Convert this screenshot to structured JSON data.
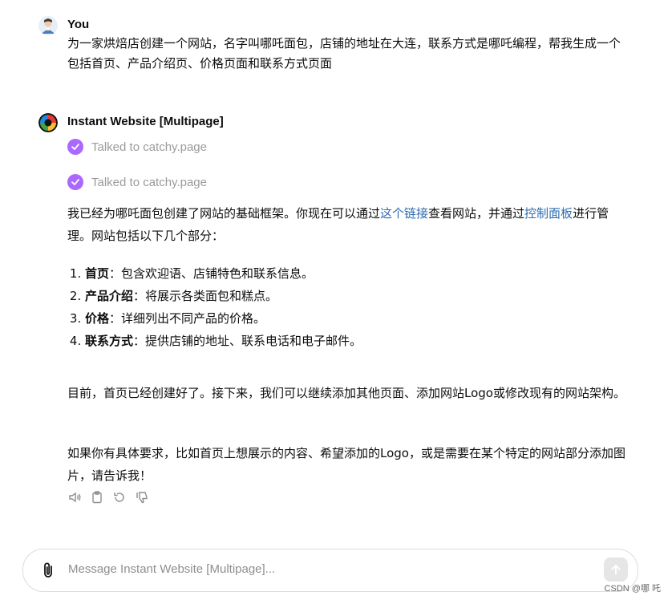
{
  "user_message": {
    "author": "You",
    "text": "为一家烘焙店创建一个网站，名字叫哪吒面包，店铺的地址在大连，联系方式是哪吒编程，帮我生成一个包括首页、产品介绍页、价格页面和联系方式页面"
  },
  "assistant_message": {
    "author": "Instant Website [Multipage]",
    "tool_calls": [
      "Talked to catchy.page",
      "Talked to catchy.page"
    ],
    "intro_1": "我已经为哪吒面包创建了网站的基础框架。你现在可以通过",
    "link_1": "这个链接",
    "intro_2": "查看网站，并通过",
    "link_2": "控制面板",
    "intro_3": "进行管理。网站包括以下几个部分：",
    "sections": [
      {
        "title": "首页",
        "desc": "：包含欢迎语、店铺特色和联系信息。"
      },
      {
        "title": "产品介绍",
        "desc": "：将展示各类面包和糕点。"
      },
      {
        "title": "价格",
        "desc": "：详细列出不同产品的价格。"
      },
      {
        "title": "联系方式",
        "desc": "：提供店铺的地址、联系电话和电子邮件。"
      }
    ],
    "para_2": "目前，首页已经创建好了。接下来，我们可以继续添加其他页面、添加网站Logo或修改现有的网站架构。",
    "para_3": "如果你有具体要求，比如首页上想展示的内容、希望添加的Logo，或是需要在某个特定的网站部分添加图片，请告诉我！"
  },
  "composer": {
    "placeholder": "Message Instant Website [Multipage]..."
  },
  "watermark": "CSDN @哪 吒",
  "colors": {
    "check_purple": "#ab68ff",
    "link_blue": "#2b6cb0",
    "muted_gray": "#9b9b9b"
  }
}
